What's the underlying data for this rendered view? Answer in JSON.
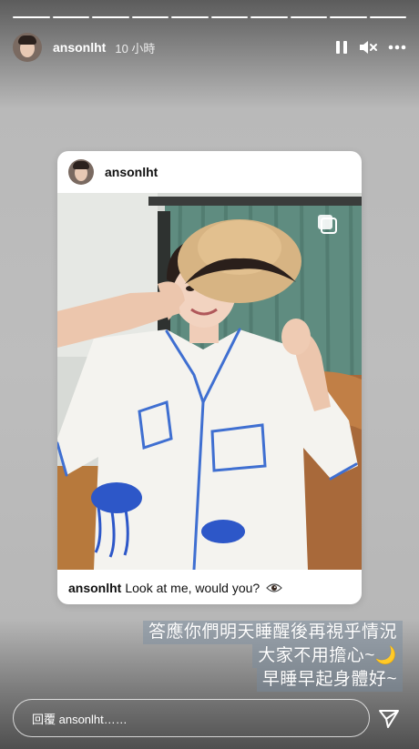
{
  "story": {
    "progress_segments": 10,
    "username": "ansonlht",
    "time": "10 小時",
    "controls": {
      "pause": "pause-icon",
      "mute": "speaker-muted-icon",
      "more": "more-options-icon"
    }
  },
  "card": {
    "username": "ansonlht",
    "caption_user": "ansonlht",
    "caption_text": "Look at me, would you?",
    "caption_icon": "eye-icon",
    "multi_photo_icon": "multiple-photos-icon"
  },
  "sticker": {
    "line1": "答應你們明天睡醒後再視乎情況",
    "line2": "大家不用擔心~🌙",
    "line3": "早睡早起身體好~"
  },
  "reply": {
    "placeholder": "回覆 ansonlht……",
    "send_icon": "send-icon"
  },
  "colors": {
    "text_light": "#ffffff",
    "card_bg": "#ffffff",
    "sticker_bg": "#788ca0"
  }
}
